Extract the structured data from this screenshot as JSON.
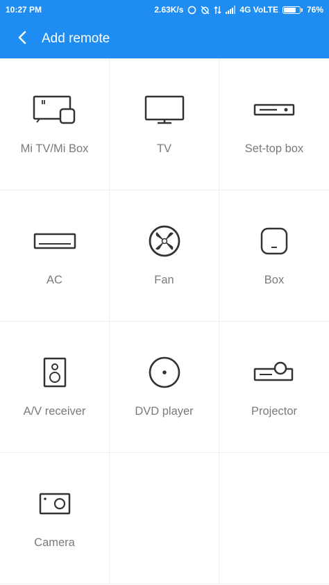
{
  "status_bar": {
    "time": "10:27 PM",
    "speed": "2.63K/s",
    "network": "4G VoLTE",
    "battery": "76%",
    "battery_level": 0.76
  },
  "app_bar": {
    "title": "Add remote",
    "back_icon": "chevron-left-icon"
  },
  "devices": [
    {
      "label": "Mi TV/Mi Box",
      "icon": "mi-tv-box-icon"
    },
    {
      "label": "TV",
      "icon": "tv-icon"
    },
    {
      "label": "Set-top box",
      "icon": "set-top-box-icon"
    },
    {
      "label": "AC",
      "icon": "ac-icon"
    },
    {
      "label": "Fan",
      "icon": "fan-icon"
    },
    {
      "label": "Box",
      "icon": "box-icon"
    },
    {
      "label": "A/V receiver",
      "icon": "av-receiver-icon"
    },
    {
      "label": "DVD player",
      "icon": "dvd-player-icon"
    },
    {
      "label": "Projector",
      "icon": "projector-icon"
    },
    {
      "label": "Camera",
      "icon": "camera-icon"
    }
  ],
  "colors": {
    "accent": "#1e8cf0",
    "label": "#7a7a7a",
    "icon_stroke": "#333333",
    "divider": "#ededed"
  }
}
